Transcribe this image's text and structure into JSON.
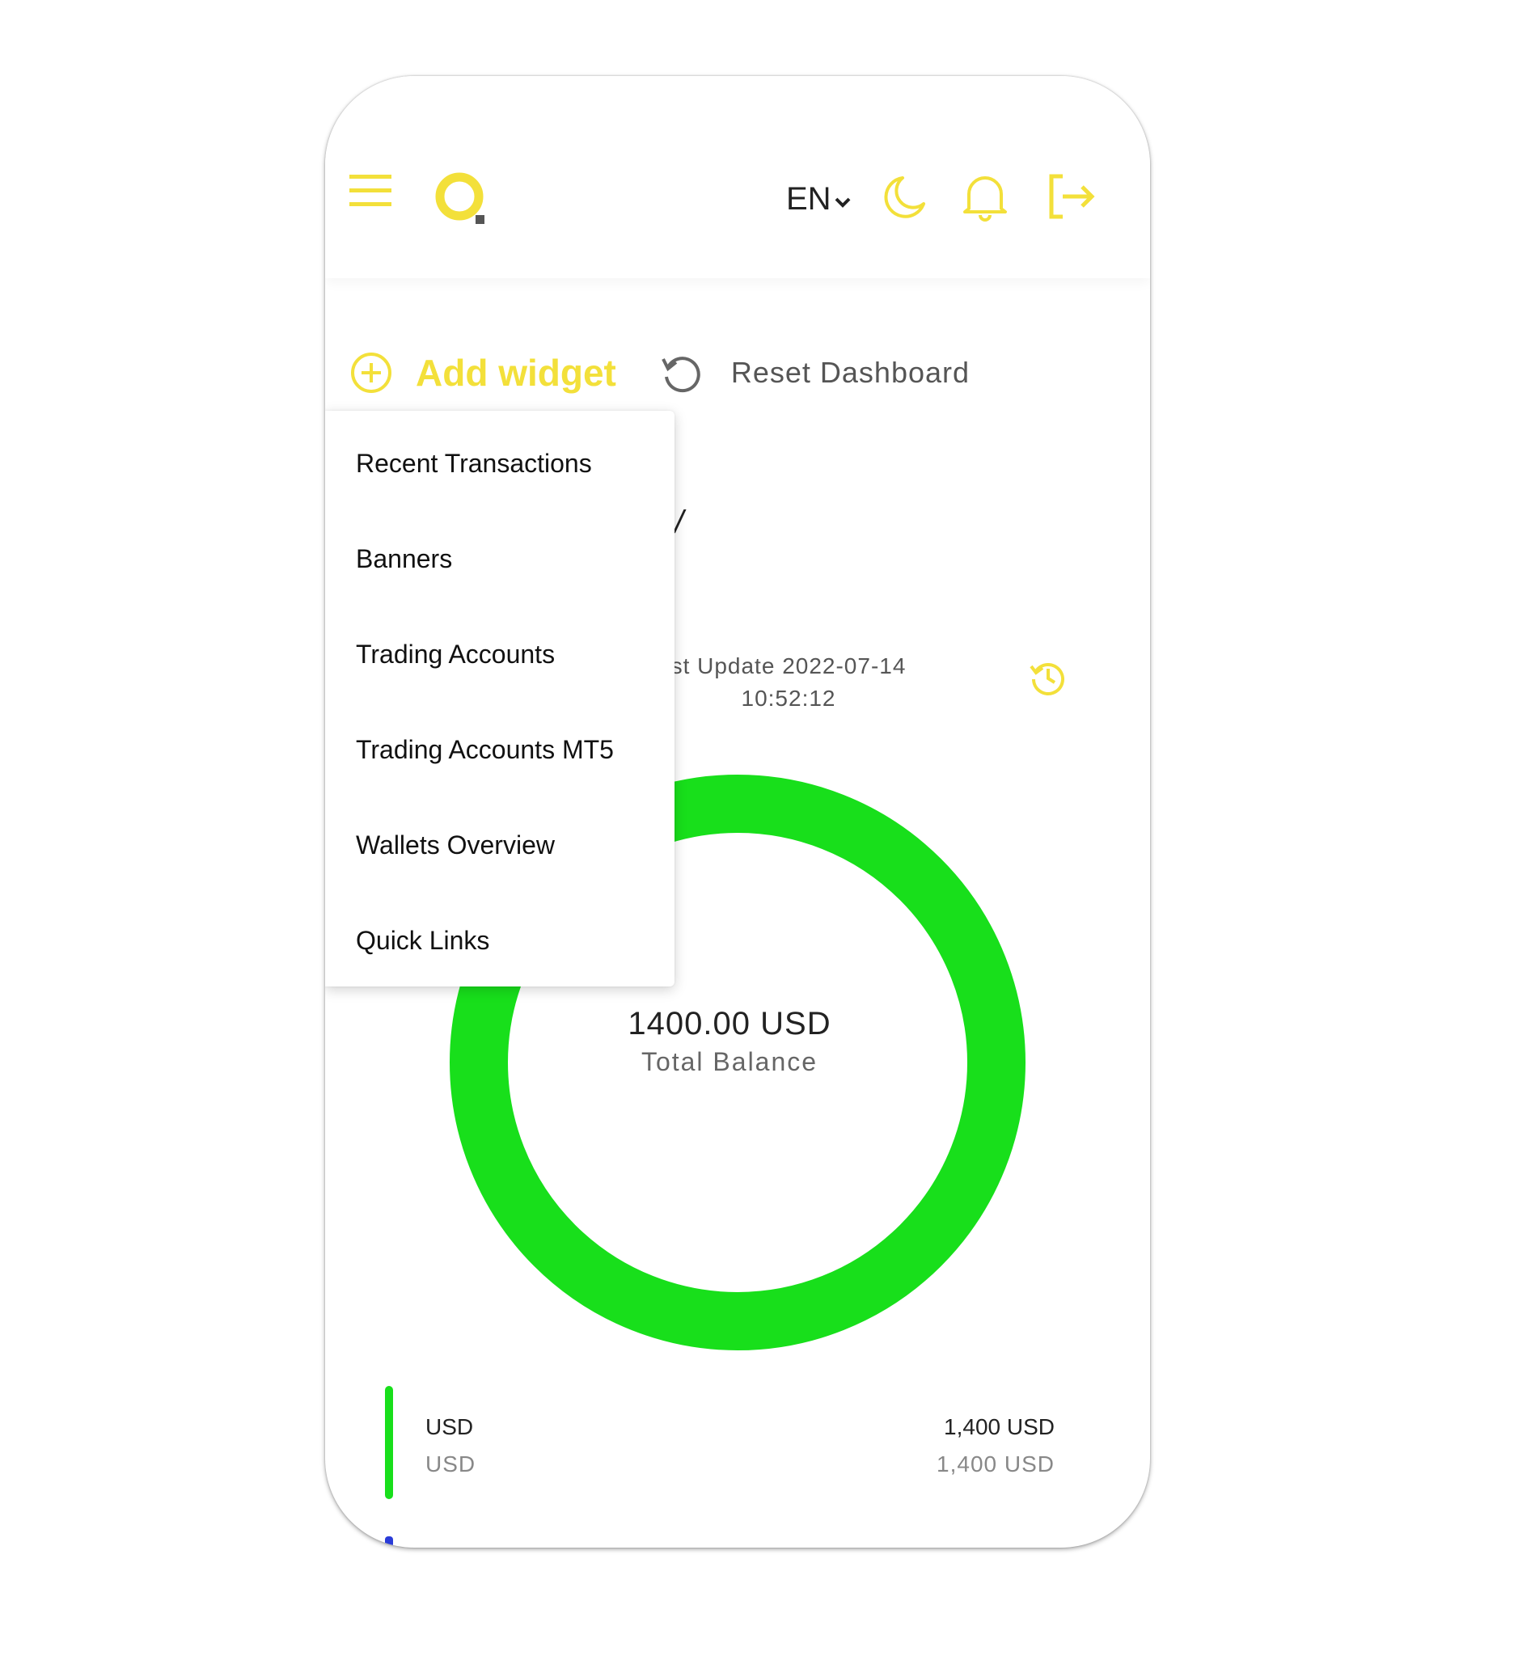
{
  "header": {
    "language": "EN",
    "icons": [
      "hamburger-menu-icon",
      "logo",
      "moon-icon",
      "bell-icon",
      "logout-icon"
    ]
  },
  "toolbar": {
    "add_widget_label": "Add widget",
    "reset_label": "Reset Dashboard"
  },
  "widget_menu": {
    "items": [
      "Recent Transactions",
      "Banners",
      "Trading Accounts",
      "Trading Accounts MT5",
      "Wallets Overview",
      "Quick Links"
    ]
  },
  "wallet": {
    "last_update": "st Update 2022-07-14",
    "last_update_time": "10:52:12",
    "total_amount": "1400.00 USD",
    "total_label": "Total Balance",
    "rows": [
      {
        "name": "USD",
        "sub": "USD",
        "amount": "1,400 USD",
        "amount_sub": "1,400 USD"
      }
    ]
  },
  "chart_data": {
    "type": "pie",
    "categories": [
      "USD"
    ],
    "values": [
      1400
    ]
  },
  "colors": {
    "accent": "#f3e03a",
    "donut": "#18df1b"
  }
}
